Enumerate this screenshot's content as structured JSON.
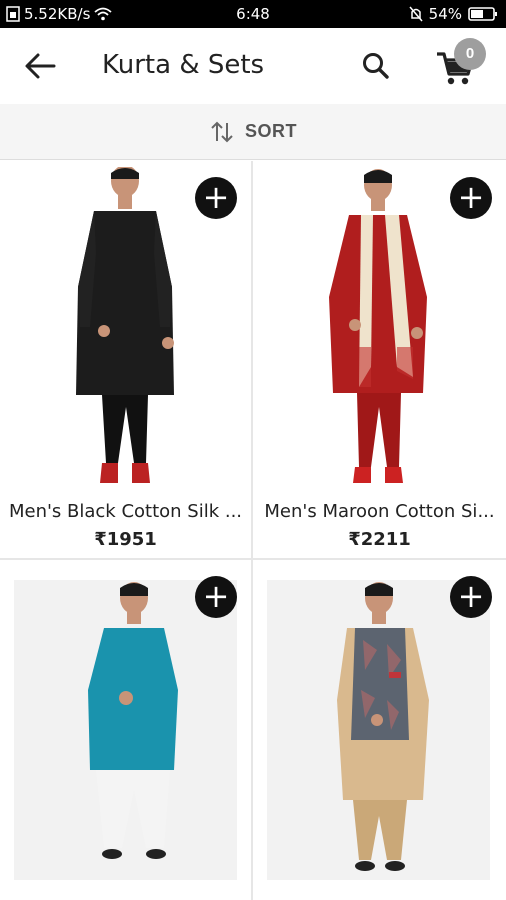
{
  "status_bar": {
    "speed": "5.52KB/s",
    "time": "6:48",
    "battery": "54%",
    "icons": [
      "data-saver-icon",
      "wifi-icon",
      "silent-icon",
      "battery-icon"
    ]
  },
  "header": {
    "title": "Kurta & Sets",
    "cart_count": "0",
    "icons": {
      "back": "back-arrow-icon",
      "search": "search-icon",
      "cart": "cart-icon"
    }
  },
  "sort": {
    "label": "SORT",
    "icon": "sort-icon"
  },
  "products": [
    {
      "name": "Men's Black Cotton Silk ...",
      "price": "₹1951",
      "colors": {
        "kurta": "#1c1c1c",
        "pant": "#111111",
        "scarf": ""
      }
    },
    {
      "name": "Men's Maroon Cotton Si...",
      "price": "₹2211",
      "colors": {
        "kurta": "#b01e1e",
        "pant": "#a01818",
        "scarf": "#efe3cc"
      }
    },
    {
      "name": "",
      "price": "",
      "colors": {
        "kurta": "#1a93ad",
        "pant": "#f4f4f4",
        "scarf": ""
      }
    },
    {
      "name": "",
      "price": "",
      "colors": {
        "kurta": "#d9b98e",
        "pant": "#caa878",
        "vest": "#5c6470"
      }
    }
  ],
  "add_label": "+"
}
